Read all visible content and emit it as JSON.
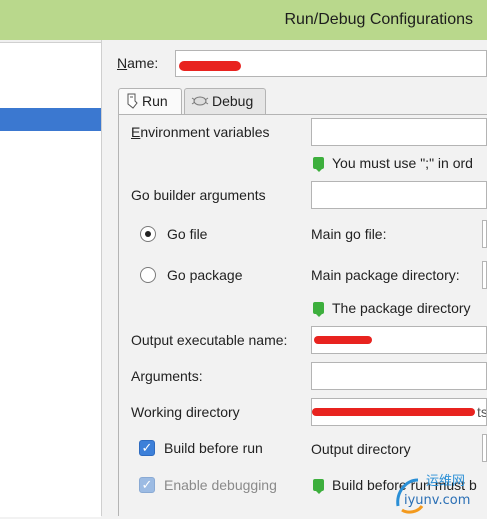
{
  "window": {
    "title": "Run/Debug Configurations"
  },
  "name_label": "Name:",
  "tabs": [
    {
      "label": "Run",
      "icon": "run-config-icon"
    },
    {
      "label": "Debug",
      "icon": "debug-bug-icon"
    }
  ],
  "form": {
    "env_label": "Environment variables",
    "env_hint": "You must use \";\" in ord",
    "builder_args_label": "Go builder arguments",
    "go_file_label": "Go file",
    "go_package_label": "Go package",
    "run_kind_selected": "Go file",
    "main_go_file_label": "Main go file:",
    "main_package_dir_label": "Main package directory:",
    "package_hint": "The package directory",
    "output_name_label": "Output executable name:",
    "arguments_label": "Arguments:",
    "working_dir_label": "Working directory",
    "working_dir_value_tail": "ts",
    "build_before_run_label": "Build before run",
    "build_before_run_checked": true,
    "output_directory_label": "Output directory",
    "enable_debugging_label": "Enable debugging",
    "enable_debugging_checked": true,
    "build_hint": "Build before run must b"
  },
  "watermark": {
    "line1": "运维网",
    "line2": "iyunv.com"
  },
  "colors": {
    "titlebar": "#b9d88c",
    "selection": "#3b78d0",
    "redaction": "#e8231f",
    "hint_icon": "#3daf3d",
    "checkbox": "#3d80d9"
  }
}
